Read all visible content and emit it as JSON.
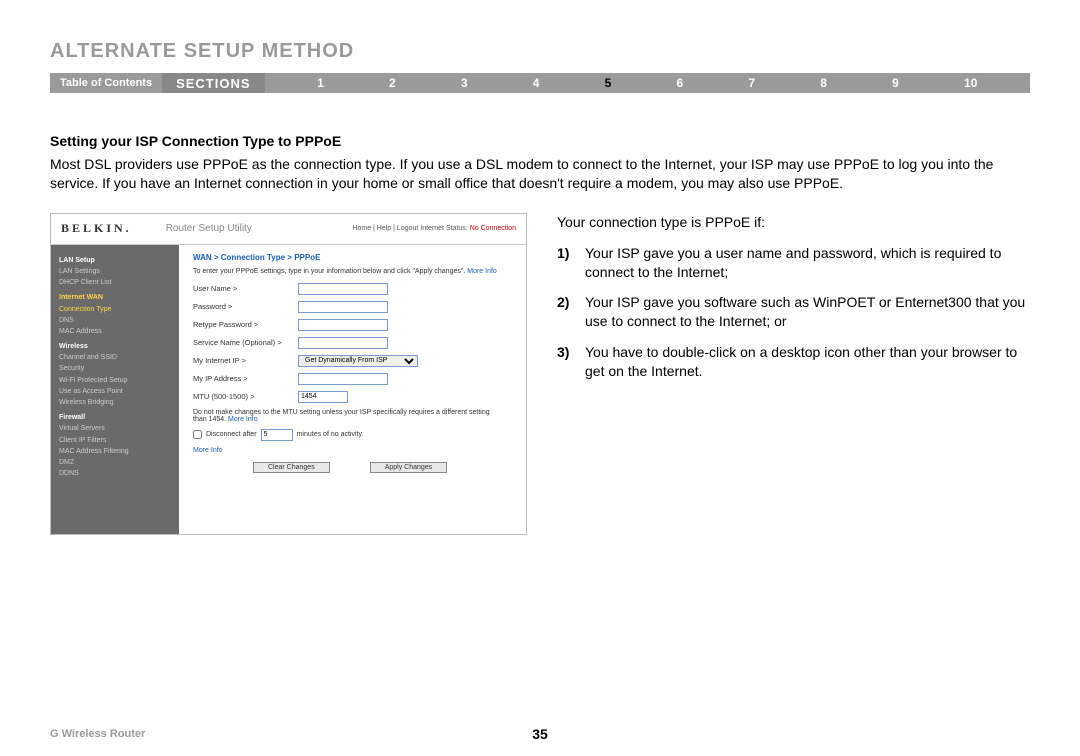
{
  "header": {
    "title": "ALTERNATE SETUP METHOD",
    "toc": "Table of Contents",
    "sections_label": "SECTIONS",
    "nums": [
      "1",
      "2",
      "3",
      "4",
      "5",
      "6",
      "7",
      "8",
      "9",
      "10"
    ],
    "active": "5"
  },
  "content": {
    "subheading": "Setting your ISP Connection Type to PPPoE",
    "body": "Most DSL providers use PPPoE as the connection type. If you use a DSL modem to connect to the Internet, your ISP may use PPPoE to log you into the service. If you have an Internet connection in your home or small office that doesn't require a modem, you may also use PPPoE.",
    "right_lead": "Your connection type is PPPoE if:",
    "list": [
      {
        "n": "1)",
        "t": "Your ISP gave you a user name and password, which is required to connect to the Internet;"
      },
      {
        "n": "2)",
        "t": "Your ISP gave you software such as WinPOET or Enternet300 that you use to connect to the Internet; or"
      },
      {
        "n": "3)",
        "t": "You have to double-click on a desktop icon other than your browser to get on the Internet."
      }
    ]
  },
  "router": {
    "logo": "BELKIN.",
    "utility": "Router Setup Utility",
    "top_links": "Home | Help | Logout   Internet Status: ",
    "top_status": "No Connection",
    "breadcrumb": "WAN > Connection Type > PPPoE",
    "hint": "To enter your PPPoE settings, type in your information below and click \"Apply changes\". ",
    "more": "More Info",
    "fields": {
      "user": "User Name >",
      "password": "Password >",
      "retype": "Retype Password >",
      "service": "Service Name (Optional) >",
      "myip": "My Internet IP >",
      "myip_opt": "Get Dynamically From ISP",
      "myaddr": "My IP Address >",
      "mtu": "MTU (500-1500) >",
      "mtu_val": "1454"
    },
    "mtu_note": "Do not make changes to the MTU setting unless your ISP specifically requires a different setting than 1454. ",
    "disconnect_label": "Disconnect after",
    "disconnect_tail": "minutes of no activity.",
    "disconnect_val": "5",
    "more_info": "More Info",
    "clear_btn": "Clear Changes",
    "apply_btn": "Apply Changes",
    "sidebar": {
      "lan_head": "LAN Setup",
      "lan_settings": "LAN Settings",
      "dhcp": "DHCP Client List",
      "wan_head": "Internet WAN",
      "conn_type": "Connection Type",
      "dns": "DNS",
      "mac": "MAC Address",
      "wireless_head": "Wireless",
      "chan": "Channel and SSID",
      "sec": "Security",
      "wps": "Wi-Fi Protected Setup",
      "ap": "Use as Access Point",
      "bridge": "Wireless Bridging",
      "fw_head": "Firewall",
      "vs": "Virtual Servers",
      "cf": "Client IP Filters",
      "maf": "MAC Address Filtering",
      "dmz": "DMZ",
      "ddns": "DDNS"
    }
  },
  "footer": {
    "product": "G Wireless Router",
    "page": "35"
  }
}
